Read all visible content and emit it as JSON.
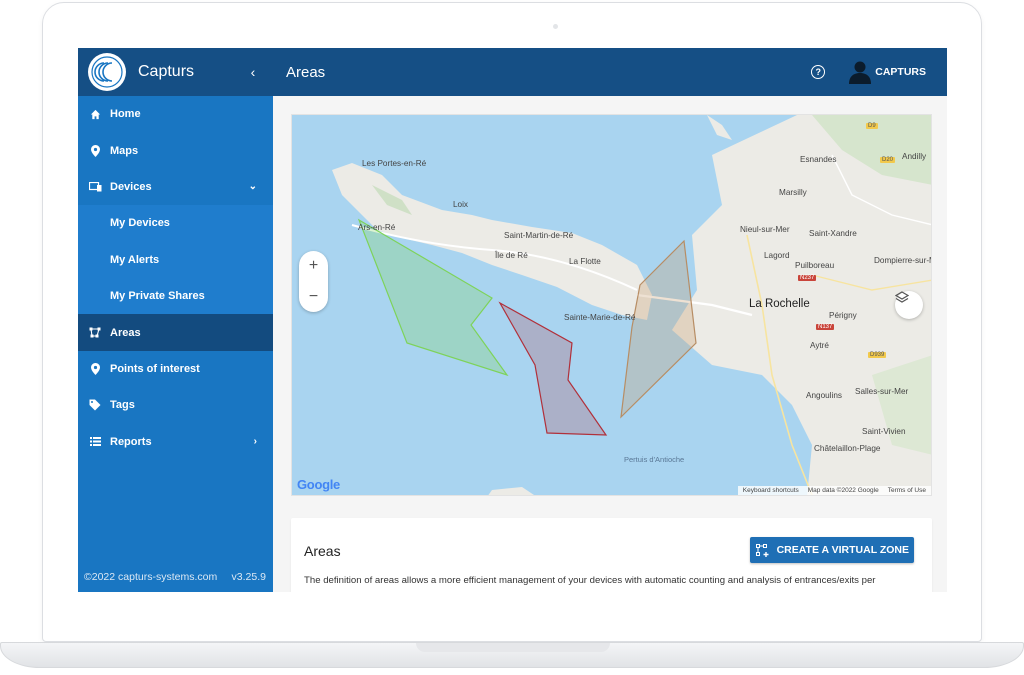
{
  "app": {
    "name": "Capturs",
    "version": "v3.25.9",
    "copyright": "©2022 capturs-systems.com"
  },
  "header": {
    "title": "Areas",
    "user": "CAPTURS",
    "help_icon": "help-circle-icon"
  },
  "sidebar": {
    "items": [
      {
        "label": "Home",
        "icon": "home-icon"
      },
      {
        "label": "Maps",
        "icon": "map-marker-icon"
      },
      {
        "label": "Devices",
        "icon": "devices-icon"
      },
      {
        "label": "My Devices"
      },
      {
        "label": "My Alerts"
      },
      {
        "label": "My Private Shares"
      },
      {
        "label": "Areas",
        "icon": "areas-icon",
        "active": true
      },
      {
        "label": "Points of interest",
        "icon": "map-marker-icon"
      },
      {
        "label": "Tags",
        "icon": "tag-icon"
      },
      {
        "label": "Reports",
        "icon": "list-icon"
      }
    ]
  },
  "map": {
    "labels": {
      "les_portes": "Les Portes-en-Ré",
      "loix": "Loix",
      "ars": "Ars-en-Ré",
      "saint_martin": "Saint-Martin-de-Ré",
      "ile_de_re": "Île de Ré",
      "la_flotte": "La Flotte",
      "sainte_marie": "Sainte-Marie-de-Ré",
      "esnandes": "Esnandes",
      "andilly": "Andilly",
      "marsilly": "Marsilly",
      "nieul": "Nieul-sur-Mer",
      "saint_xandre": "Saint-Xandre",
      "lagord": "Lagord",
      "puilboreau": "Puilboreau",
      "dompierre": "Dompierre-sur-Mer",
      "la_rochelle": "La Rochelle",
      "perigny": "Périgny",
      "aytre": "Aytré",
      "angoulins": "Angoulins",
      "salles": "Salles-sur-Mer",
      "saint_vivien": "Saint-Vivien",
      "chatelaillon": "Châtelaillon-Plage",
      "pertuis": "Pertuis d'Antioche"
    },
    "roads": {
      "d9": "D9",
      "d20": "D20",
      "n237": "N237",
      "n137": "N137",
      "d939": "D939"
    },
    "zoom_in": "+",
    "zoom_out": "−",
    "google": "Google",
    "attribution": {
      "shortcuts": "Keyboard shortcuts",
      "data": "Map data ©2022 Google",
      "terms": "Terms of Use"
    },
    "zone_colors": {
      "green": "#7ed35a",
      "red": "#b1303a",
      "orange": "#c79a6e"
    }
  },
  "card": {
    "title": "Areas",
    "button": "CREATE A VIRTUAL ZONE",
    "description": "The definition of areas allows a more efficient management of your devices with automatic counting and analysis of entrances/exits per"
  },
  "colors": {
    "sidebar": "#1976c2",
    "topbar": "#154f85",
    "active": "#134b7f",
    "button": "#1f6fb5"
  }
}
